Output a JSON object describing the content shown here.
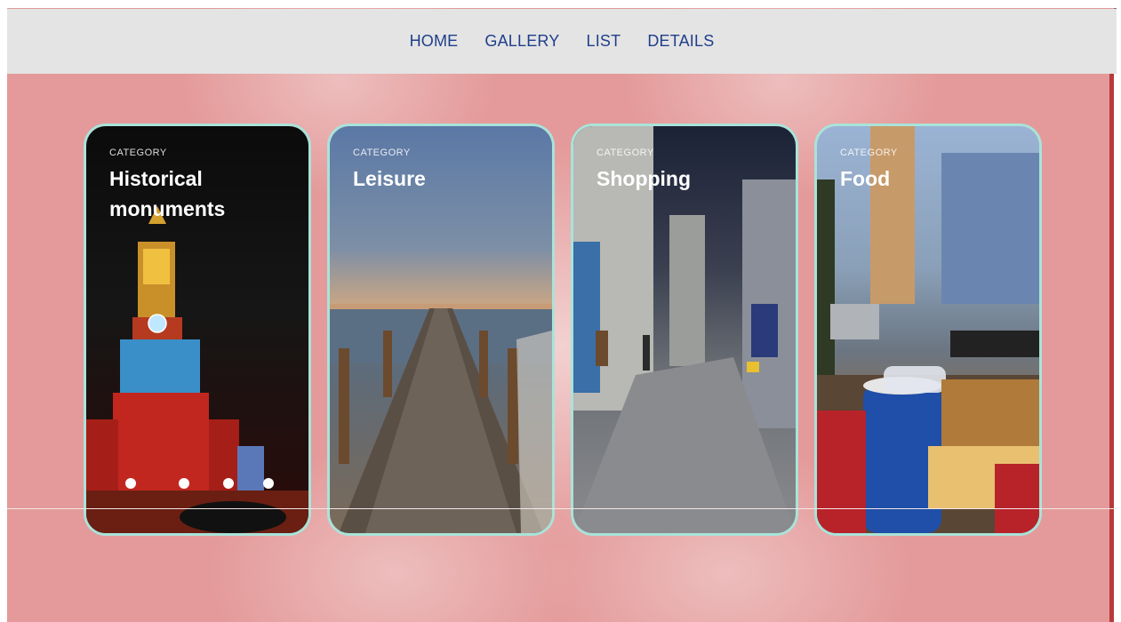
{
  "nav": {
    "items": [
      "HOME",
      "GALLERY",
      "LIST",
      "DETAILS"
    ]
  },
  "cards": [
    {
      "category": "CATEGORY",
      "title": "Historical monuments",
      "image": "illuminated-clock-tower"
    },
    {
      "category": "CATEGORY",
      "title": "Leisure",
      "image": "seaside-pier-sunset"
    },
    {
      "category": "CATEGORY",
      "title": "Shopping",
      "image": "night-market-street"
    },
    {
      "category": "CATEGORY",
      "title": "Food",
      "image": "fast-food-drinks-table"
    }
  ],
  "colors": {
    "background": "#e49a9a",
    "navbar": "#e4e4e4",
    "nav_text": "#1f3f8a",
    "card_border": "#a9e3d9"
  }
}
